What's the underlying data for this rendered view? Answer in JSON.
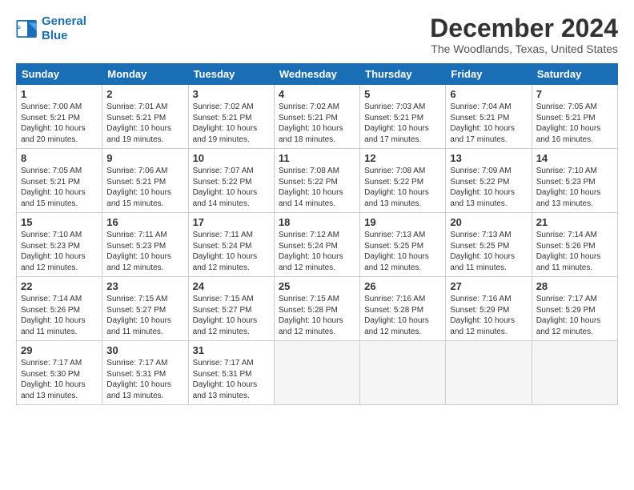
{
  "header": {
    "logo_line1": "General",
    "logo_line2": "Blue",
    "month_title": "December 2024",
    "location": "The Woodlands, Texas, United States"
  },
  "weekdays": [
    "Sunday",
    "Monday",
    "Tuesday",
    "Wednesday",
    "Thursday",
    "Friday",
    "Saturday"
  ],
  "weeks": [
    [
      {
        "day": "1",
        "info": "Sunrise: 7:00 AM\nSunset: 5:21 PM\nDaylight: 10 hours\nand 20 minutes."
      },
      {
        "day": "2",
        "info": "Sunrise: 7:01 AM\nSunset: 5:21 PM\nDaylight: 10 hours\nand 19 minutes."
      },
      {
        "day": "3",
        "info": "Sunrise: 7:02 AM\nSunset: 5:21 PM\nDaylight: 10 hours\nand 19 minutes."
      },
      {
        "day": "4",
        "info": "Sunrise: 7:02 AM\nSunset: 5:21 PM\nDaylight: 10 hours\nand 18 minutes."
      },
      {
        "day": "5",
        "info": "Sunrise: 7:03 AM\nSunset: 5:21 PM\nDaylight: 10 hours\nand 17 minutes."
      },
      {
        "day": "6",
        "info": "Sunrise: 7:04 AM\nSunset: 5:21 PM\nDaylight: 10 hours\nand 17 minutes."
      },
      {
        "day": "7",
        "info": "Sunrise: 7:05 AM\nSunset: 5:21 PM\nDaylight: 10 hours\nand 16 minutes."
      }
    ],
    [
      {
        "day": "8",
        "info": "Sunrise: 7:05 AM\nSunset: 5:21 PM\nDaylight: 10 hours\nand 15 minutes."
      },
      {
        "day": "9",
        "info": "Sunrise: 7:06 AM\nSunset: 5:21 PM\nDaylight: 10 hours\nand 15 minutes."
      },
      {
        "day": "10",
        "info": "Sunrise: 7:07 AM\nSunset: 5:22 PM\nDaylight: 10 hours\nand 14 minutes."
      },
      {
        "day": "11",
        "info": "Sunrise: 7:08 AM\nSunset: 5:22 PM\nDaylight: 10 hours\nand 14 minutes."
      },
      {
        "day": "12",
        "info": "Sunrise: 7:08 AM\nSunset: 5:22 PM\nDaylight: 10 hours\nand 13 minutes."
      },
      {
        "day": "13",
        "info": "Sunrise: 7:09 AM\nSunset: 5:22 PM\nDaylight: 10 hours\nand 13 minutes."
      },
      {
        "day": "14",
        "info": "Sunrise: 7:10 AM\nSunset: 5:23 PM\nDaylight: 10 hours\nand 13 minutes."
      }
    ],
    [
      {
        "day": "15",
        "info": "Sunrise: 7:10 AM\nSunset: 5:23 PM\nDaylight: 10 hours\nand 12 minutes."
      },
      {
        "day": "16",
        "info": "Sunrise: 7:11 AM\nSunset: 5:23 PM\nDaylight: 10 hours\nand 12 minutes."
      },
      {
        "day": "17",
        "info": "Sunrise: 7:11 AM\nSunset: 5:24 PM\nDaylight: 10 hours\nand 12 minutes."
      },
      {
        "day": "18",
        "info": "Sunrise: 7:12 AM\nSunset: 5:24 PM\nDaylight: 10 hours\nand 12 minutes."
      },
      {
        "day": "19",
        "info": "Sunrise: 7:13 AM\nSunset: 5:25 PM\nDaylight: 10 hours\nand 12 minutes."
      },
      {
        "day": "20",
        "info": "Sunrise: 7:13 AM\nSunset: 5:25 PM\nDaylight: 10 hours\nand 11 minutes."
      },
      {
        "day": "21",
        "info": "Sunrise: 7:14 AM\nSunset: 5:26 PM\nDaylight: 10 hours\nand 11 minutes."
      }
    ],
    [
      {
        "day": "22",
        "info": "Sunrise: 7:14 AM\nSunset: 5:26 PM\nDaylight: 10 hours\nand 11 minutes."
      },
      {
        "day": "23",
        "info": "Sunrise: 7:15 AM\nSunset: 5:27 PM\nDaylight: 10 hours\nand 11 minutes."
      },
      {
        "day": "24",
        "info": "Sunrise: 7:15 AM\nSunset: 5:27 PM\nDaylight: 10 hours\nand 12 minutes."
      },
      {
        "day": "25",
        "info": "Sunrise: 7:15 AM\nSunset: 5:28 PM\nDaylight: 10 hours\nand 12 minutes."
      },
      {
        "day": "26",
        "info": "Sunrise: 7:16 AM\nSunset: 5:28 PM\nDaylight: 10 hours\nand 12 minutes."
      },
      {
        "day": "27",
        "info": "Sunrise: 7:16 AM\nSunset: 5:29 PM\nDaylight: 10 hours\nand 12 minutes."
      },
      {
        "day": "28",
        "info": "Sunrise: 7:17 AM\nSunset: 5:29 PM\nDaylight: 10 hours\nand 12 minutes."
      }
    ],
    [
      {
        "day": "29",
        "info": "Sunrise: 7:17 AM\nSunset: 5:30 PM\nDaylight: 10 hours\nand 13 minutes."
      },
      {
        "day": "30",
        "info": "Sunrise: 7:17 AM\nSunset: 5:31 PM\nDaylight: 10 hours\nand 13 minutes."
      },
      {
        "day": "31",
        "info": "Sunrise: 7:17 AM\nSunset: 5:31 PM\nDaylight: 10 hours\nand 13 minutes."
      },
      {
        "day": "",
        "info": ""
      },
      {
        "day": "",
        "info": ""
      },
      {
        "day": "",
        "info": ""
      },
      {
        "day": "",
        "info": ""
      }
    ]
  ]
}
